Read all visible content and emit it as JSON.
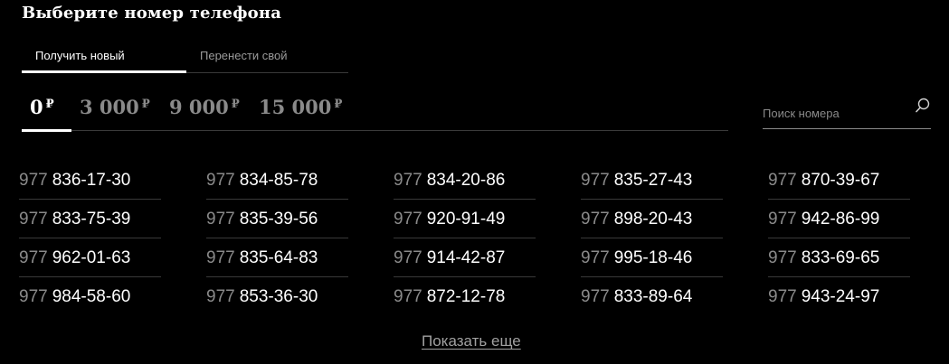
{
  "title": "Выберите номер телефона",
  "tabs": [
    {
      "label": "Получить новый",
      "active": true
    },
    {
      "label": "Перенести свой",
      "active": false
    }
  ],
  "prices": [
    {
      "amount": "0",
      "currency": "₽",
      "active": true
    },
    {
      "amount": "3 000",
      "currency": "₽",
      "active": false
    },
    {
      "amount": "9 000",
      "currency": "₽",
      "active": false
    },
    {
      "amount": "15 000",
      "currency": "₽",
      "active": false
    }
  ],
  "search": {
    "placeholder": "Поиск номера",
    "icon": "search-icon"
  },
  "numbers": {
    "prefix": "977",
    "columns": [
      [
        "836-17-30",
        "833-75-39",
        "962-01-63",
        "984-58-60"
      ],
      [
        "834-85-78",
        "835-39-56",
        "835-64-83",
        "853-36-30"
      ],
      [
        "834-20-86",
        "920-91-49",
        "914-42-87",
        "872-12-78"
      ],
      [
        "835-27-43",
        "898-20-43",
        "995-18-46",
        "833-89-64"
      ],
      [
        "870-39-67",
        "942-86-99",
        "833-69-65",
        "943-24-97"
      ]
    ]
  },
  "show_more": "Показать еще",
  "colors": {
    "background": "#000000",
    "text": "#ffffff",
    "muted": "#8a8a8a",
    "divider": "#3a3a3a"
  }
}
